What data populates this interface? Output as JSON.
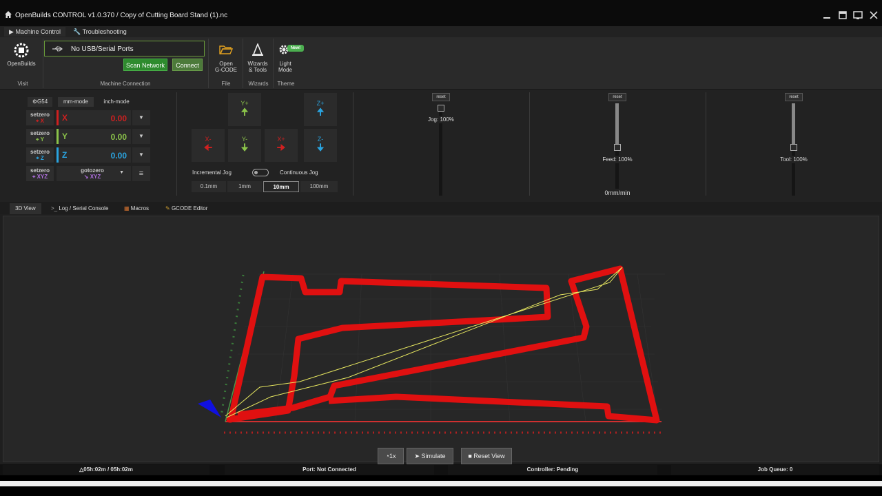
{
  "window": {
    "title": "OpenBuilds CONTROL v1.0.370 / Copy of Cutting Board Stand (1).nc"
  },
  "ribbon_tabs": [
    {
      "label": "Machine Control"
    },
    {
      "label": "Troubleshooting"
    }
  ],
  "ribbon": {
    "openbuilds_label": "OpenBuilds",
    "visit_label": "Visit",
    "port_text": "No USB/Serial Ports",
    "scan_network": "Scan Network",
    "connect": "Connect",
    "machine_connection_label": "Machine Connection",
    "open_gcode_line1": "Open",
    "open_gcode_line2": "G-CODE",
    "file_label": "File",
    "wizards_line1": "Wizards",
    "wizards_line2": "& Tools",
    "wizards_label": "Wizards",
    "light_line1": "Light",
    "light_line2": "Mode",
    "new_badge": "New!",
    "theme_label": "Theme"
  },
  "dro": {
    "g54": "G54",
    "mm_mode": "mm-mode",
    "inch_mode": "inch-mode",
    "setzero": "setzero",
    "axes": [
      {
        "name": "X",
        "value": "0.00",
        "color": "#d02020"
      },
      {
        "name": "Y",
        "value": "0.00",
        "color": "#8bc34a"
      },
      {
        "name": "Z",
        "value": "0.00",
        "color": "#2aa4e0"
      }
    ],
    "all_axes": "XYZ",
    "gotozero": "gotozero"
  },
  "jog": {
    "y_plus": "Y+",
    "y_minus": "Y-",
    "x_plus": "X+",
    "x_minus": "X-",
    "z_plus": "Z+",
    "z_minus": "Z-",
    "incremental": "Incremental Jog",
    "continuous": "Continuous Jog",
    "steps": [
      "0.1mm",
      "1mm",
      "10mm",
      "100mm"
    ],
    "active_step": "10mm"
  },
  "overrides": {
    "reset": "reset",
    "jog": {
      "label": "Jog: 100%",
      "level": 1.0
    },
    "feed": {
      "label": "Feed: 100%",
      "level": 1.0,
      "rate": "0mm/min"
    },
    "tool": {
      "label": "Tool: 100%",
      "level": 1.0
    }
  },
  "view_tabs": [
    {
      "label": "3D View"
    },
    {
      "label": "Log / Serial Console"
    },
    {
      "label": "Macros"
    },
    {
      "label": "GCODE Editor"
    }
  ],
  "view_buttons": {
    "speed": "1x",
    "simulate": "Simulate",
    "reset_view": "Reset View"
  },
  "status": {
    "time": "05h:02m / 05h:02m",
    "port": "Port: Not Connected",
    "controller": "Controller: Pending",
    "queue": "Job Queue: 0"
  },
  "colors": {
    "toolpath": "#e01010",
    "rapid": "#e8e860",
    "green_button": "#2e8b2e",
    "connect_button": "#4c7a3a"
  }
}
